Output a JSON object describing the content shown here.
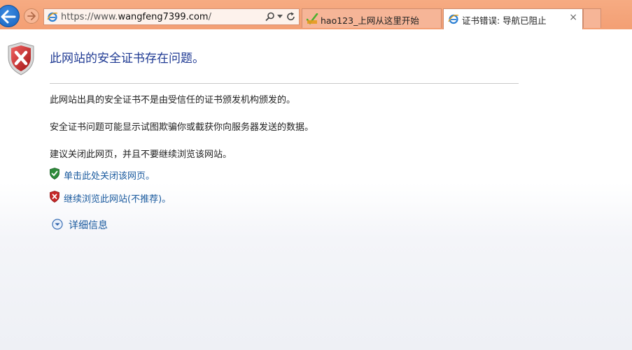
{
  "toolbar": {
    "back_icon": "back-arrow-icon",
    "forward_icon": "forward-arrow-icon"
  },
  "address_bar": {
    "url_prefix": "https://www.",
    "url_domain": "wangfeng7399.com",
    "url_suffix": "/",
    "search_icon": "search-icon",
    "refresh_icon": "refresh-icon"
  },
  "tabs": [
    {
      "title": "hao123_上网从这里开始",
      "active": false
    },
    {
      "title": "证书错误: 导航已阻止",
      "active": true,
      "close": "×"
    }
  ],
  "page": {
    "title": "此网站的安全证书存在问题。",
    "messages": [
      "此网站出具的安全证书不是由受信任的证书颁发机构颁发的。",
      "安全证书问题可能显示试图欺骗你或截获你向服务器发送的数据。",
      "建议关闭此网页，并且不要继续浏览该网站。"
    ],
    "close_link": "单击此处关闭该网页。",
    "continue_link": "继续浏览此网站(不推荐)。",
    "details_link": "详细信息"
  },
  "colors": {
    "chrome": "#f3a074",
    "title": "#1f3a93",
    "link": "#1a5a9e",
    "shield_red": "#c62828",
    "shield_green": "#2e8b3a"
  }
}
